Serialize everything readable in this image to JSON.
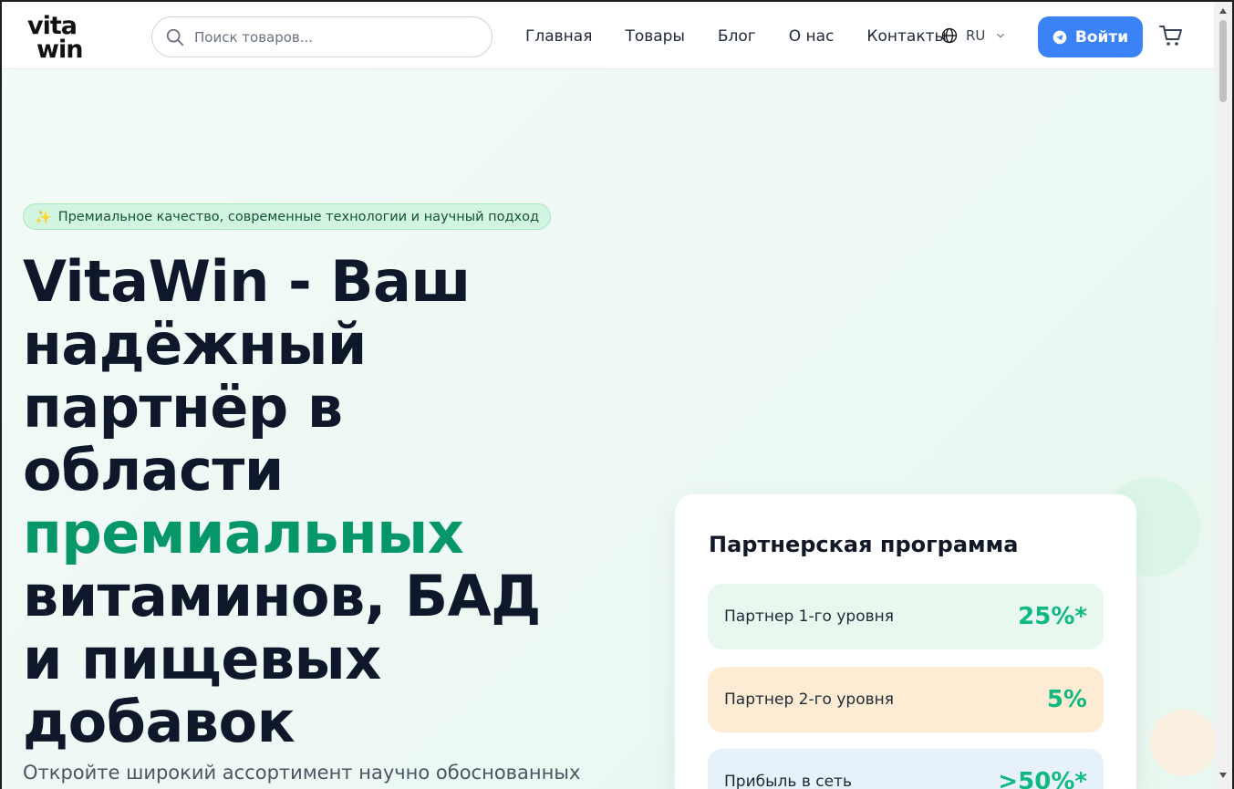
{
  "header": {
    "logo_text": "vita win",
    "search": {
      "placeholder": "Поиск товаров..."
    },
    "nav": [
      "Главная",
      "Товары",
      "Блог",
      "О нас",
      "Контакты"
    ],
    "language": "RU",
    "login_label": "Войти"
  },
  "hero": {
    "badge_text": "Премиальное качество, современные технологии и научный подход",
    "title_part1": "VitaWin - Ваш надёжный партнёр в области",
    "title_accent": "премиальных",
    "title_part2": "витаминов, БАД и пищевых добавок",
    "subtitle": "Откройте широкий ассортимент научно обоснованных"
  },
  "partner_card": {
    "title": "Партнерская программа",
    "rows": [
      {
        "label": "Партнер 1-го уровня",
        "value": "25%*"
      },
      {
        "label": "Партнер 2-го уровня",
        "value": "5%"
      },
      {
        "label": "Прибыль в сеть",
        "value": ">50%*"
      }
    ]
  },
  "colors": {
    "accent_green": "#059669",
    "value_green": "#10b981",
    "button_blue": "#3b82f6",
    "title_dark": "#0f172a"
  },
  "icons": [
    "search-icon",
    "globe-icon",
    "chevron-down-icon",
    "telegram-icon",
    "cart-icon",
    "sparkles-icon"
  ]
}
